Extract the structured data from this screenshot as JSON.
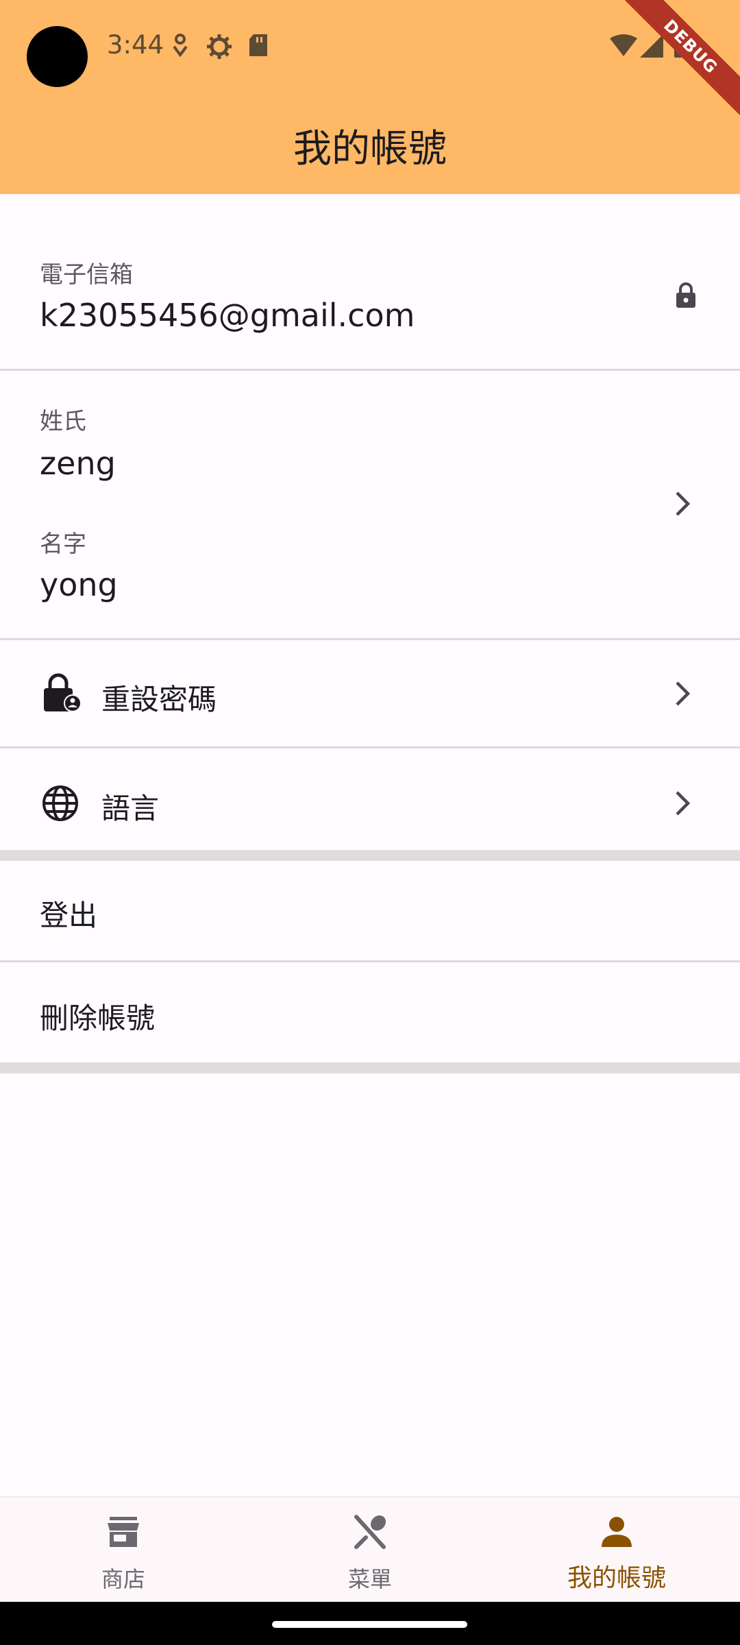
{
  "status_bar": {
    "time": "3:44"
  },
  "debug_banner": "DEBUG",
  "app_bar": {
    "title": "我的帳號"
  },
  "account": {
    "email_label": "電子信箱",
    "email_value": "k23055456@gmail.com",
    "last_name_label": "姓氏",
    "last_name_value": "zeng",
    "first_name_label": "名字",
    "first_name_value": "yong"
  },
  "menu": {
    "reset_password": "重設密碼",
    "language": "語言",
    "logout": "登出",
    "delete_account": "刪除帳號"
  },
  "bottom_nav": {
    "items": [
      {
        "label": "商店",
        "icon": "store-icon"
      },
      {
        "label": "菜單",
        "icon": "restaurant-icon"
      },
      {
        "label": "我的帳號",
        "icon": "person-icon",
        "active": true
      }
    ]
  },
  "colors": {
    "app_bar": "#ffb866",
    "active_nav": "#8a5200"
  }
}
